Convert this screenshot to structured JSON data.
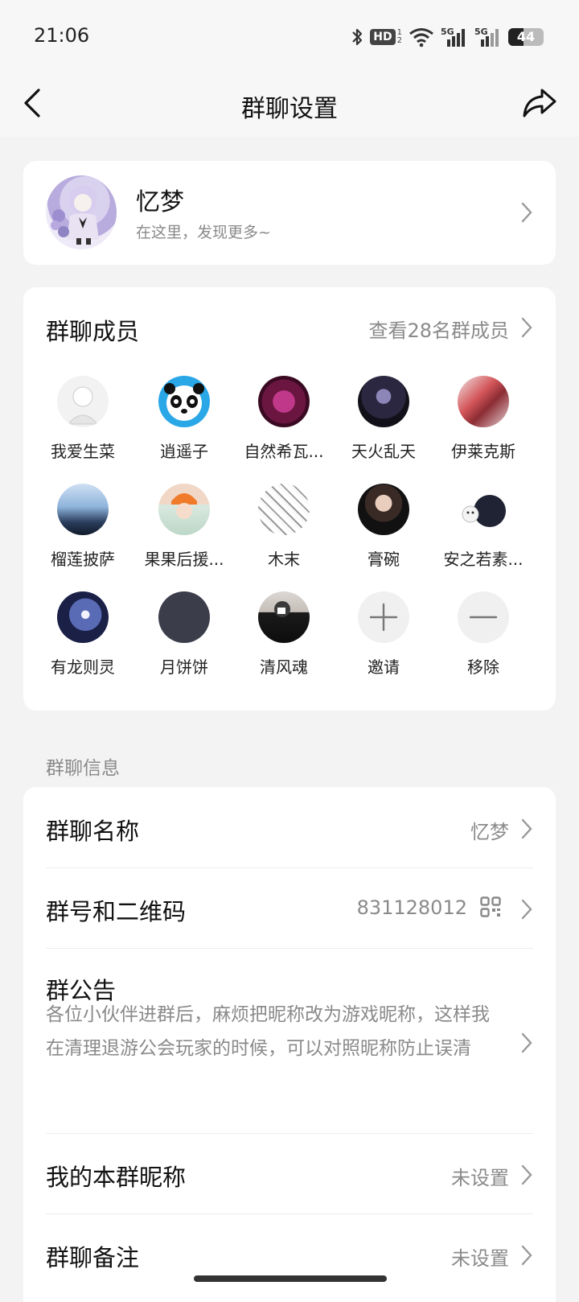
{
  "status_bar": {
    "time": "21:06",
    "battery": "44",
    "hd_label": "HD",
    "net1": "5G",
    "net2": "5G",
    "icons": [
      "bluetooth-icon",
      "hd-voice-icon",
      "wifi-icon",
      "signal-5g-icon",
      "signal-5g-icon",
      "battery-icon"
    ]
  },
  "nav": {
    "title": "群聊设置",
    "back_icon": "chevron-left-icon",
    "share_icon": "share-icon"
  },
  "profile": {
    "name": "忆梦",
    "subtitle": "在这里，发现更多~"
  },
  "members": {
    "title": "群聊成员",
    "view_all": "查看28名群成员",
    "items": [
      {
        "name": "我爱生菜"
      },
      {
        "name": "逍遥子"
      },
      {
        "name": "自然希瓦..."
      },
      {
        "name": "天火乱天"
      },
      {
        "name": "伊莱克斯"
      },
      {
        "name": "榴莲披萨"
      },
      {
        "name": "果果后援..."
      },
      {
        "name": "木末"
      },
      {
        "name": "膏碗"
      },
      {
        "name": "安之若素..."
      },
      {
        "name": "有龙则灵"
      },
      {
        "name": "月饼饼"
      },
      {
        "name": "清风魂"
      }
    ],
    "invite_label": "邀请",
    "remove_label": "移除"
  },
  "info": {
    "section_label": "群聊信息",
    "group_name_label": "群聊名称",
    "group_name_value": "忆梦",
    "group_id_label": "群号和二维码",
    "group_id_value": "831128012",
    "notice_label": "群公告",
    "notice_text": "各位小伙伴进群后，麻烦把昵称改为游戏昵称，这样我在清理退游公会玩家的时候，可以对照昵称防止误清",
    "my_nickname_label": "我的本群昵称",
    "my_nickname_value": "未设置",
    "remark_label": "群聊备注",
    "remark_value": "未设置"
  }
}
